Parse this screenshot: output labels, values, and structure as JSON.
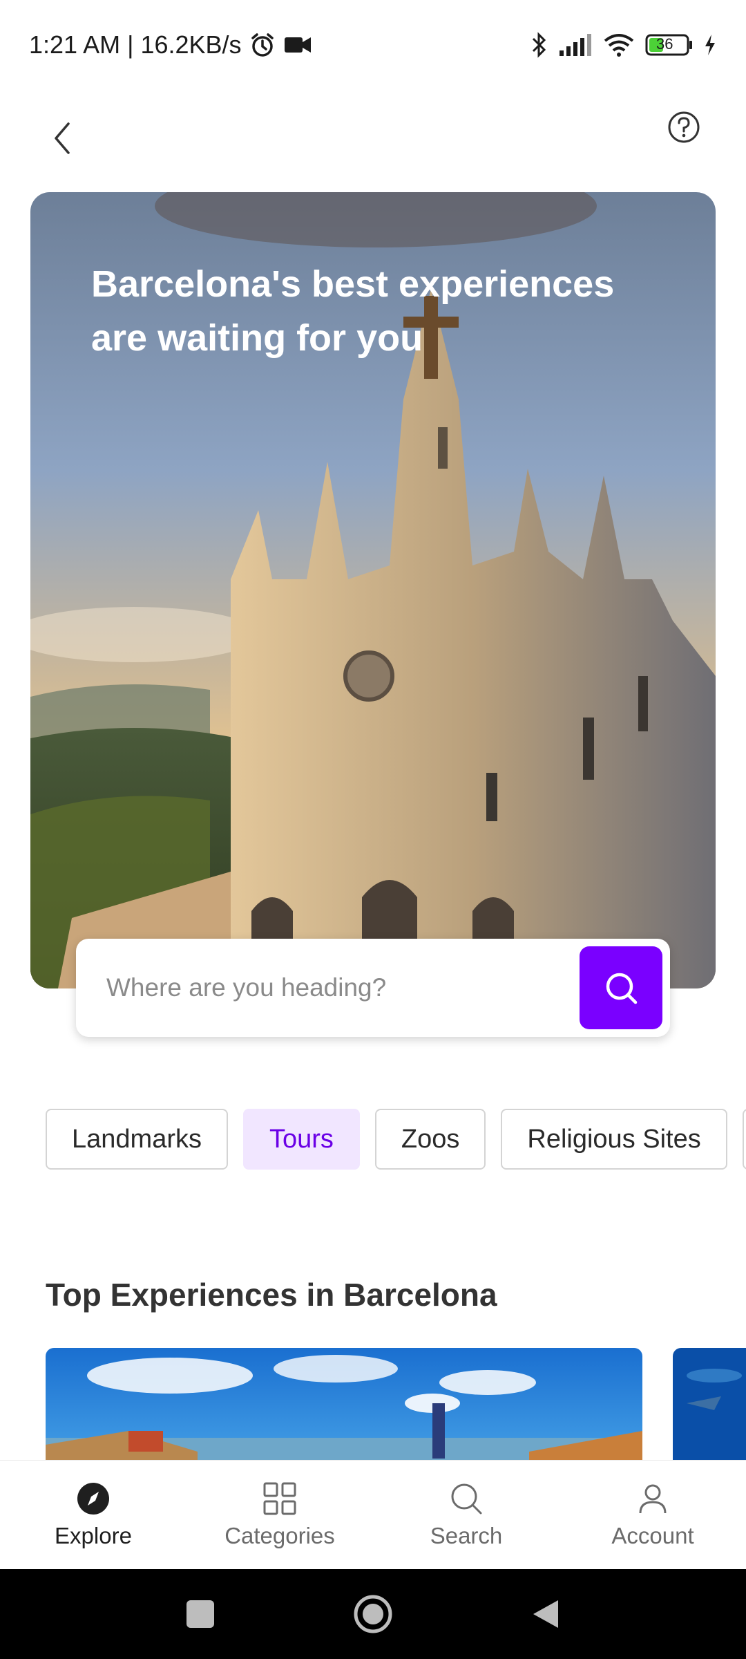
{
  "status_bar": {
    "time_info": "1:21 AM | 16.2KB/s",
    "battery": "36"
  },
  "hero": {
    "title": "Barcelona's best experiences are waiting for you"
  },
  "search": {
    "placeholder": "Where are you heading?"
  },
  "chips": [
    {
      "label": "Landmarks",
      "active": false
    },
    {
      "label": "Tours",
      "active": true
    },
    {
      "label": "Zoos",
      "active": false
    },
    {
      "label": "Religious Sites",
      "active": false
    }
  ],
  "section": {
    "title": "Top Experiences in Barcelona"
  },
  "bottom_nav": {
    "items": [
      {
        "label": "Explore",
        "icon": "compass-icon",
        "active": true
      },
      {
        "label": "Categories",
        "icon": "grid-icon",
        "active": false
      },
      {
        "label": "Search",
        "icon": "search-icon",
        "active": false
      },
      {
        "label": "Account",
        "icon": "user-icon",
        "active": false
      }
    ]
  },
  "colors": {
    "accent": "#7a00ff",
    "chip_active_bg": "#f1e6ff",
    "chip_active_text": "#6a00e6"
  }
}
